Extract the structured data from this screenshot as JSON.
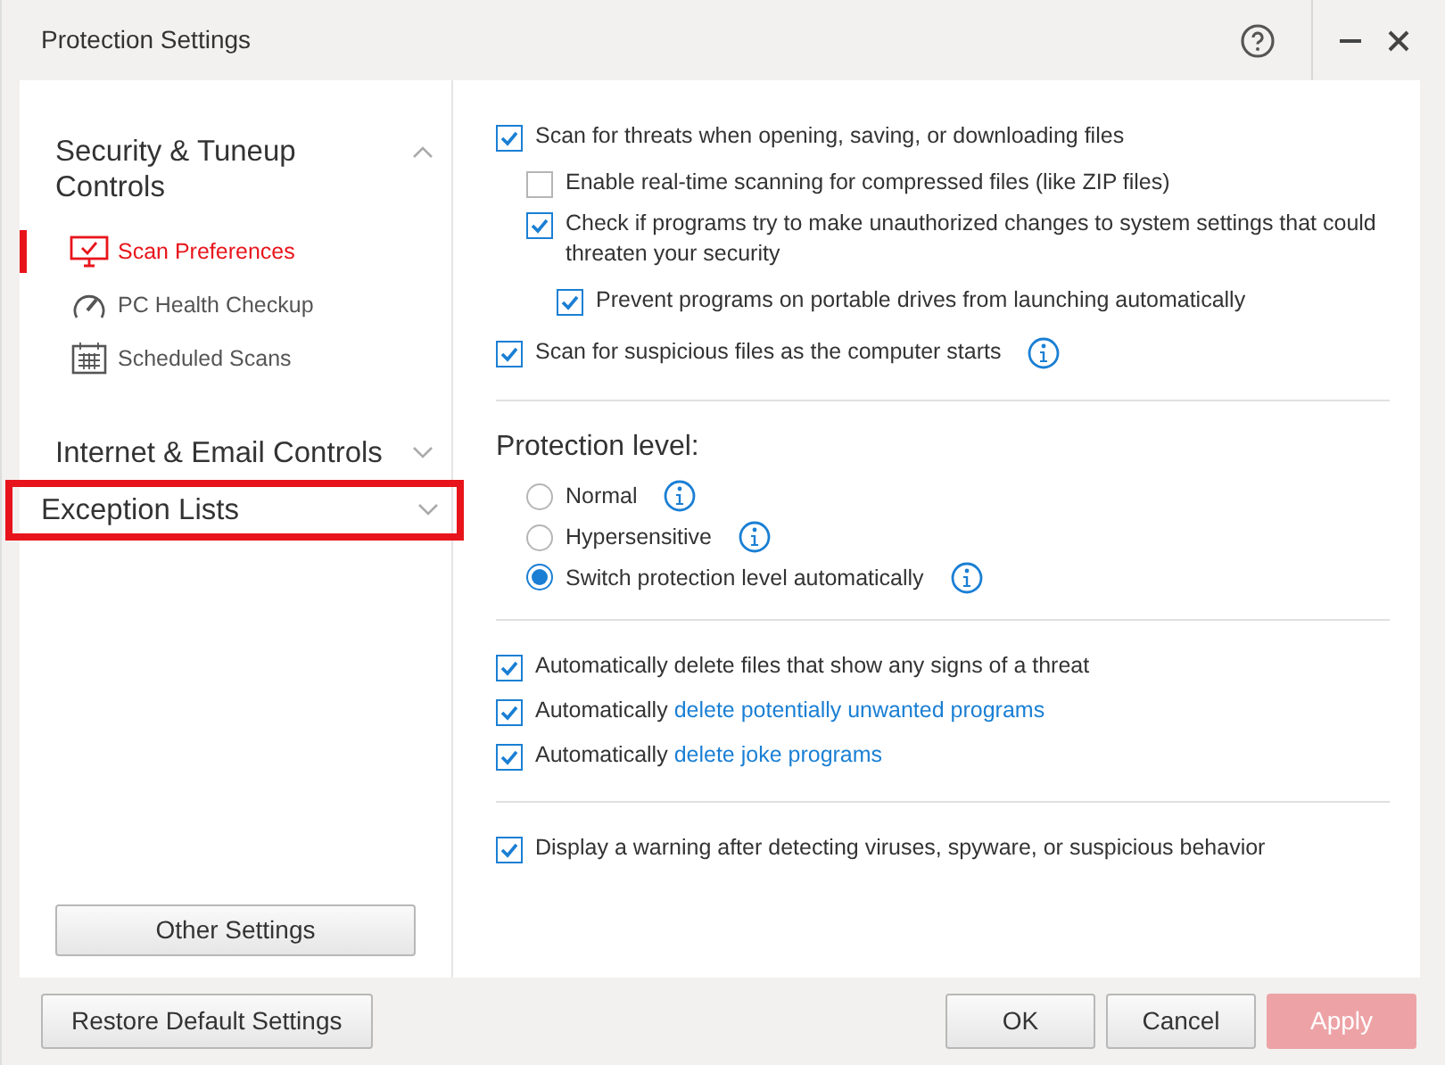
{
  "window": {
    "title": "Protection Settings"
  },
  "sidebar": {
    "groups": [
      {
        "title": "Security & Tuneup Controls",
        "expanded": true,
        "highlighted": false,
        "items": [
          {
            "label": "Scan Preferences",
            "selected": true
          },
          {
            "label": "PC Health Checkup",
            "selected": false
          },
          {
            "label": "Scheduled Scans",
            "selected": false
          }
        ]
      },
      {
        "title": "Internet & Email Controls",
        "expanded": false,
        "highlighted": false
      },
      {
        "title": "Exception Lists",
        "expanded": false,
        "highlighted": true
      }
    ],
    "button": "Other Settings"
  },
  "sections": [
    {
      "kind": "checkboxes",
      "items": [
        {
          "label": "Scan for threats when opening, saving, or downloading files",
          "checked": true,
          "info": false,
          "children": [
            {
              "label": "Enable real-time scanning for compressed files (like ZIP files)",
              "checked": false,
              "info": false
            },
            {
              "label": "Check if programs try to make unauthorized changes to system settings that could threaten your security",
              "checked": true,
              "info": false,
              "children": [
                {
                  "label": "Prevent programs on portable drives from launching automatically",
                  "checked": true,
                  "info": false
                }
              ]
            }
          ]
        },
        {
          "label": "Scan for suspicious files as the computer starts",
          "checked": true,
          "info": true
        }
      ]
    },
    {
      "kind": "radios",
      "heading": "Protection level:",
      "items": [
        {
          "label": "Normal",
          "selected": false,
          "info": true
        },
        {
          "label": "Hypersensitive",
          "selected": false,
          "info": true
        },
        {
          "label": "Switch protection level automatically",
          "selected": true,
          "info": true
        }
      ]
    },
    {
      "kind": "checkboxes",
      "items": [
        {
          "label": "Automatically delete files that show any signs of a threat",
          "checked": true,
          "info": false
        },
        {
          "label": "Automatically ",
          "link": "delete potentially unwanted programs",
          "checked": true,
          "info": false
        },
        {
          "label": "Automatically ",
          "link": "delete joke programs",
          "checked": true,
          "info": false
        }
      ]
    },
    {
      "kind": "checkboxes",
      "items": [
        {
          "label": "Display a warning after detecting viruses, spyware, or suspicious behavior",
          "checked": true,
          "info": false
        }
      ]
    }
  ],
  "footer": {
    "left": [
      {
        "label": "Restore Default Settings",
        "disabled": false
      }
    ],
    "right": [
      {
        "label": "OK",
        "kind": "normal",
        "disabled": false
      },
      {
        "label": "Cancel",
        "kind": "normal",
        "disabled": false
      },
      {
        "label": "Apply",
        "kind": "primary",
        "disabled": true
      }
    ]
  }
}
